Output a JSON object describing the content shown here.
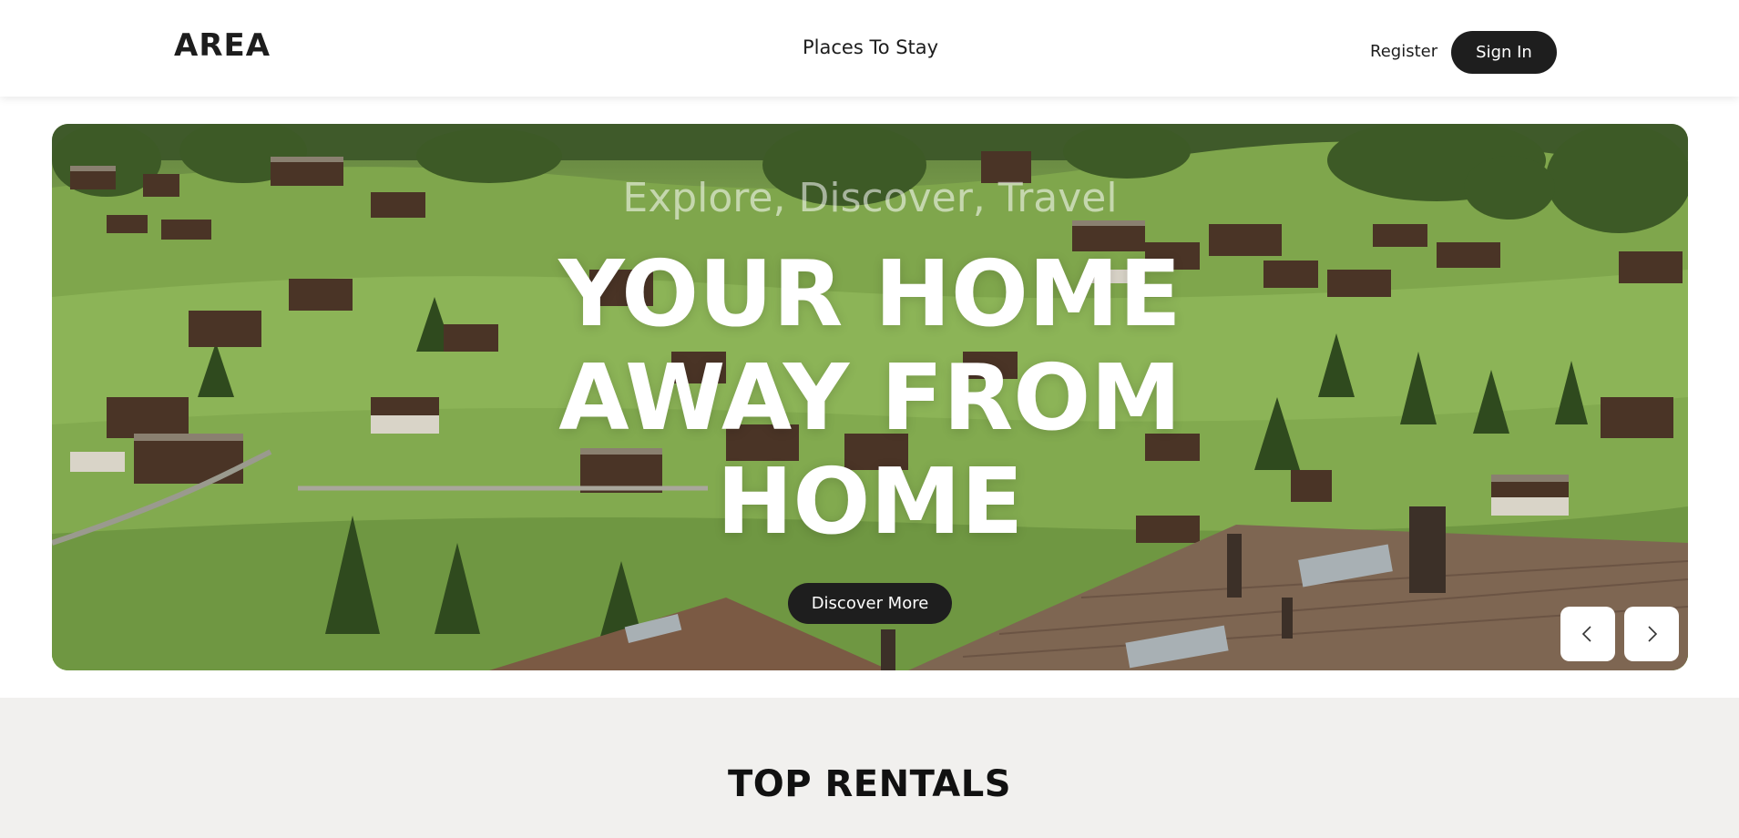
{
  "header": {
    "logo": "AREA",
    "nav_link": "Places To Stay",
    "register_label": "Register",
    "signin_label": "Sign In"
  },
  "hero": {
    "subtitle": "Explore, Discover, Travel",
    "title": "YOUR HOME\nAWAY FROM\nHOME",
    "discover_label": "Discover More",
    "prev_icon": "chevron-left-icon",
    "next_icon": "chevron-right-icon"
  },
  "section": {
    "title": "TOP RENTALS"
  },
  "colors": {
    "primary_dark": "#1e1e1e",
    "section_bg": "#f1f0ee",
    "hero_green": "#86ad52"
  }
}
